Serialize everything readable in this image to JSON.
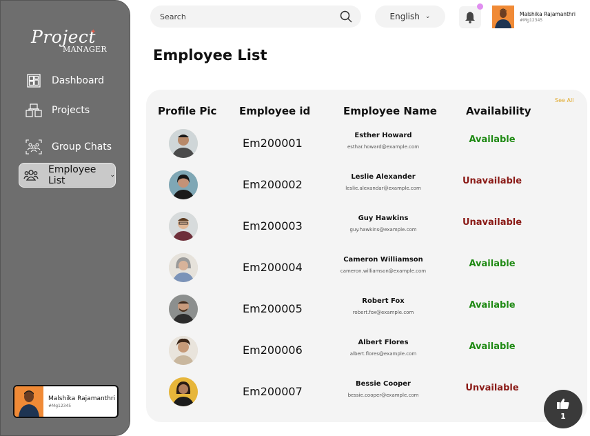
{
  "app": {
    "logo_text": "Project",
    "logo_sub": "MANAGER"
  },
  "sidebar": {
    "items": [
      {
        "label": "Dashboard",
        "icon": "dashboard-icon"
      },
      {
        "label": "Projects",
        "icon": "projects-icon"
      },
      {
        "label": "Group Chats",
        "icon": "group-chats-icon"
      },
      {
        "label": "Employee List",
        "icon": "employee-list-icon",
        "active": true
      }
    ],
    "user": {
      "name": "Malshika Rajamanthri",
      "id": "#Mg12345"
    }
  },
  "topbar": {
    "search_placeholder": "Search",
    "language": "English",
    "user": {
      "name": "Malshika Rajamanthri",
      "id": "#Mg12345"
    }
  },
  "page": {
    "title": "Employee List",
    "see_all": "See All"
  },
  "table": {
    "headers": [
      "Profile Pic",
      "Employee id",
      "Employee Name",
      "Availability"
    ],
    "rows": [
      {
        "id": "Em200001",
        "name": "Esther Howard",
        "email": "esthar.howard@example.com",
        "status": "Available",
        "ok": true
      },
      {
        "id": "Em200002",
        "name": "Leslie Alexander",
        "email": "leslie.alexandar@example.com",
        "status": "Unavailable",
        "ok": false
      },
      {
        "id": "Em200003",
        "name": "Guy Hawkins",
        "email": "guy.hawkins@example.com",
        "status": "Unavailable",
        "ok": false
      },
      {
        "id": "Em200004",
        "name": "Cameron Williamson",
        "email": "cameron.williamson@example.com",
        "status": "Available",
        "ok": true
      },
      {
        "id": "Em200005",
        "name": "Robert Fox",
        "email": "robert.fox@example.com",
        "status": "Available",
        "ok": true
      },
      {
        "id": "Em200006",
        "name": "Albert Flores",
        "email": "albert.flores@example.com",
        "status": "Available",
        "ok": true
      },
      {
        "id": "Em200007",
        "name": "Bessie Cooper",
        "email": "bessie.cooper@example.com",
        "status": "Unvailable",
        "ok": false
      }
    ]
  },
  "like": {
    "count": "1"
  },
  "colors": {
    "sidebar": "#6e6e6e",
    "available": "#1f8a14",
    "unavailable": "#8a1a16",
    "see_all": "#e0a92a",
    "notification_dot": "#e08ef0"
  }
}
